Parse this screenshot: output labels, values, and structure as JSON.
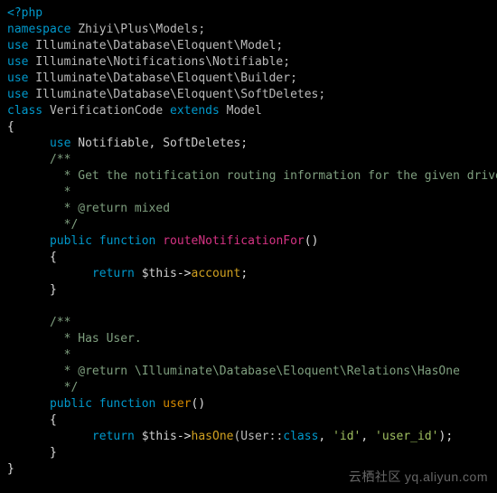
{
  "code": {
    "open_tag": "<?php",
    "namespace_kw": "namespace",
    "namespace_path": " Zhiyi\\Plus\\Models;",
    "use_kw": "use",
    "use1": " Illuminate\\Database\\Eloquent\\Model;",
    "use2": " Illuminate\\Notifications\\Notifiable;",
    "use3": " Illuminate\\Database\\Eloquent\\Builder;",
    "use4": " Illuminate\\Database\\Eloquent\\SoftDeletes;",
    "class_kw": "class",
    "class_name": " VerificationCode ",
    "extends_kw": "extends",
    "extends_name": " Model",
    "brace_open": "{",
    "indent": "      ",
    "indent2": "            ",
    "use_traits_kw": "use",
    "use_traits": " Notifiable, SoftDeletes;",
    "doc1_open": "/**",
    "doc1_l1": "  * Get the notification routing information for the given driver.",
    "doc1_l2": "  *",
    "doc1_l3": "  * @return mixed",
    "doc1_close": "  */",
    "public_kw": "public",
    "function_kw": " function ",
    "method1": "routeNotificationFor",
    "parens": "()",
    "return_kw": "return",
    "this_var": " $this",
    "arrow": "->",
    "prop_account": "account",
    "semi": ";",
    "brace_close": "}",
    "doc2_open": "/**",
    "doc2_l1": "  * Has User.",
    "doc2_l2": "  *",
    "doc2_l3": "  * @return \\Illuminate\\Database\\Eloquent\\Relations\\HasOne",
    "doc2_close": "  */",
    "method2": "user",
    "hasOne": "hasOne",
    "hasOne_args_open": "(User::",
    "class_const": "class",
    "comma1": ", ",
    "str_id": "'id'",
    "comma2": ", ",
    "str_userid": "'user_id'",
    "close_paren": ")"
  },
  "watermark": {
    "zh": "云栖社区",
    "url": "yq.aliyun.com"
  }
}
